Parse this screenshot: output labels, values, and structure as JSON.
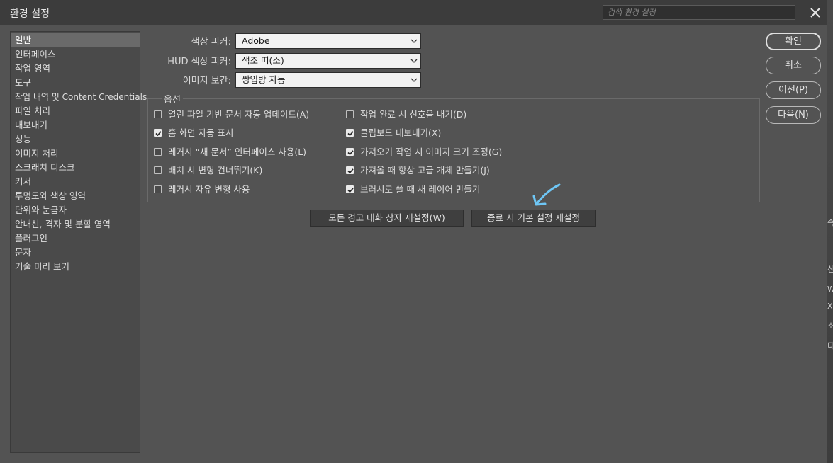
{
  "window": {
    "title": "환경 설정",
    "search_placeholder": "검색 환경 설정"
  },
  "sidebar": {
    "items": [
      {
        "label": "일반"
      },
      {
        "label": "인터페이스"
      },
      {
        "label": "작업 영역"
      },
      {
        "label": "도구"
      },
      {
        "label": "작업 내역 및 Content Credentials"
      },
      {
        "label": "파일 처리"
      },
      {
        "label": "내보내기"
      },
      {
        "label": "성능"
      },
      {
        "label": "이미지 처리"
      },
      {
        "label": "스크래치 디스크"
      },
      {
        "label": "커서"
      },
      {
        "label": "투명도와 색상 영역"
      },
      {
        "label": "단위와 눈금자"
      },
      {
        "label": "안내선, 격자 및 분할 영역"
      },
      {
        "label": "플러그인"
      },
      {
        "label": "문자"
      },
      {
        "label": "기술 미리 보기"
      }
    ],
    "selected_index": 0
  },
  "fields": {
    "color_picker": {
      "label": "색상 피커:",
      "value": "Adobe"
    },
    "hud_color_picker": {
      "label": "HUD 색상 피커:",
      "value": "색조 띠(소)"
    },
    "image_interpolation": {
      "label": "이미지 보간:",
      "value": "쌍입방 자동"
    }
  },
  "options": {
    "title": "옵션",
    "left": [
      {
        "label": "열린 파일 기반 문서 자동 업데이트(A)",
        "checked": false
      },
      {
        "label": "홈 화면 자동 표시",
        "checked": true
      },
      {
        "label": "레거시 “새 문서” 인터페이스 사용(L)",
        "checked": false
      },
      {
        "label": "배치 시 변형 건너뛰기(K)",
        "checked": false
      },
      {
        "label": "레거시 자유 변형 사용",
        "checked": false
      }
    ],
    "right": [
      {
        "label": "작업 완료 시 신호음 내기(D)",
        "checked": false
      },
      {
        "label": "클립보드 내보내기(X)",
        "checked": true
      },
      {
        "label": "가져오기 작업 시 이미지 크기 조정(G)",
        "checked": true
      },
      {
        "label": "가져올 때 항상 고급 개체 만들기(J)",
        "checked": true
      },
      {
        "label": "브러시로 쓸 때 새 레이어 만들기",
        "checked": true
      }
    ]
  },
  "buttons": {
    "reset_warnings": "모든 경고 대화 상자 재설정(W)",
    "reset_on_quit": "종료 시 기본 설정 재설정",
    "ok": "확인",
    "cancel": "취소",
    "prev": "이전(P)",
    "next": "다음(N)"
  },
  "background_fragments": [
    "속",
    "신",
    "W",
    "X",
    "소",
    "디"
  ],
  "colors": {
    "dialog_bg": "#535353",
    "titlebar_bg": "#3c3c3c",
    "annotation": "#6ec6f5"
  }
}
